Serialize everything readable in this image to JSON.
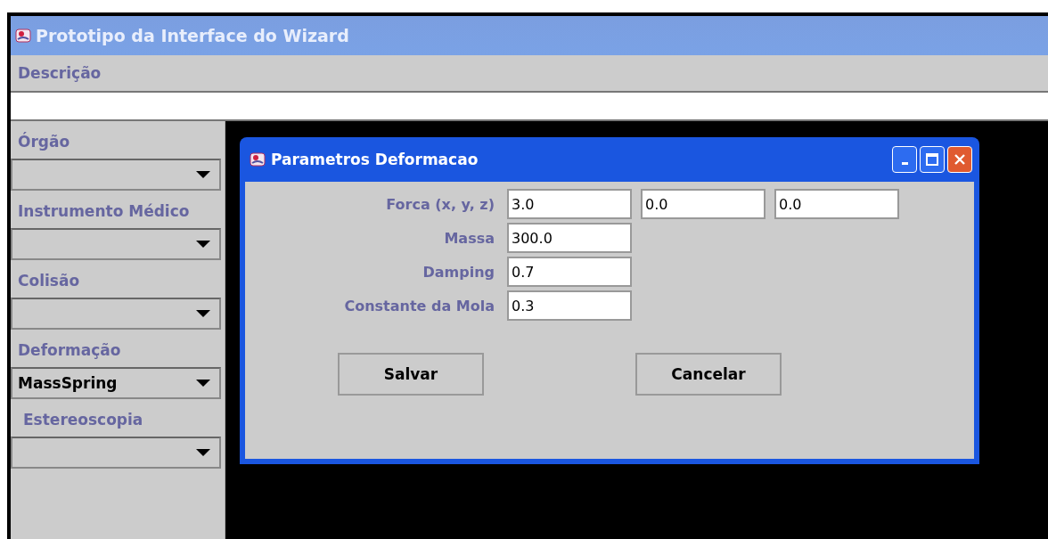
{
  "window": {
    "title": "Prototipo da Interface do Wizard"
  },
  "description": {
    "label": "Descrição"
  },
  "sidebar": [
    {
      "label": "Órgão"
    },
    {
      "label": "Instrumento Médico"
    },
    {
      "label": "Colisão"
    },
    {
      "label": "Deformação",
      "value": "MassSpring"
    },
    {
      "label": "Estereoscopia"
    }
  ],
  "dialog": {
    "title": "Parametros Deformacao",
    "fields": [
      {
        "label": "Forca (x, y, z)",
        "values": [
          "3.0",
          "0.0",
          "0.0"
        ]
      },
      {
        "label": "Massa",
        "values": [
          "300.0"
        ]
      },
      {
        "label": "Damping",
        "values": [
          "0.7"
        ]
      },
      {
        "label": "Constante da Mola",
        "values": [
          "0.3"
        ]
      }
    ],
    "buttons": [
      "Salvar",
      "Cancelar"
    ]
  }
}
